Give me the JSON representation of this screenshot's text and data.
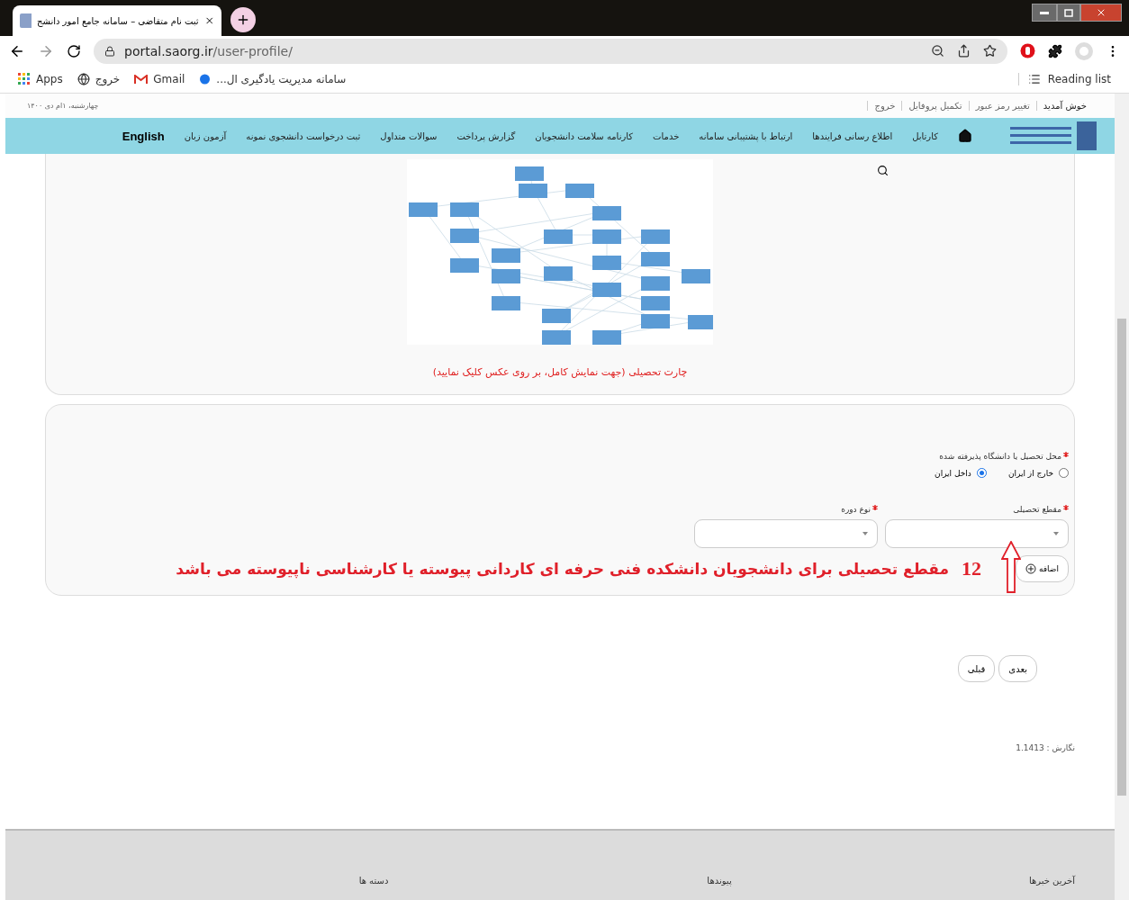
{
  "browser": {
    "tab_title": "ثبت نام متقاضی – سامانه جامع امور دانشج",
    "url_host": "portal.saorg.ir",
    "url_path": "/user-profile/",
    "bookmarks": {
      "apps": "Apps",
      "globe_link": "خروج",
      "gmail": "Gmail",
      "cloud_link": "سامانه مدیریت یادگیری ال..."
    },
    "reading_list": "Reading list"
  },
  "site": {
    "top_links": [
      "خوش آمدید",
      "تغییر رمز عبور",
      "تکمیل پروفایل",
      "خروج"
    ],
    "date": "چهارشنبه، ۱ام دی ۱۴۰۰",
    "nav": [
      {
        "kind": "home"
      },
      {
        "kind": "link",
        "label": "کارتابل"
      },
      {
        "kind": "link",
        "label": "اطلاع رسانی فرایندها"
      },
      {
        "kind": "link",
        "label": "ارتباط با پشتیبانی سامانه"
      },
      {
        "kind": "link",
        "label": "خدمات"
      },
      {
        "kind": "link",
        "label": "کارنامه سلامت دانشجویان"
      },
      {
        "kind": "link",
        "label": "گزارش پرداخت"
      },
      {
        "kind": "link",
        "label": "سوالات متداول"
      },
      {
        "kind": "link",
        "label": "ثبت درخواست دانشجوی نمونه"
      },
      {
        "kind": "link",
        "label": "آزمون زبان"
      },
      {
        "kind": "lang",
        "label": "English"
      }
    ]
  },
  "chart_caption": "چارت تحصیلی (جهت نمایش کامل، بر روی عکس کلیک نمایید)",
  "form": {
    "location_label": "محل تحصیل یا دانشگاه پذیرفته شده",
    "location_required": true,
    "radios": [
      {
        "label": "خارج از ایران",
        "selected": false
      },
      {
        "label": "داخل ایران",
        "selected": true
      }
    ],
    "fields": [
      {
        "label": "مقطع تحصیلی",
        "required": true
      },
      {
        "label": "نوع دوره",
        "required": true
      }
    ],
    "add_button": "اضافه"
  },
  "annotation": {
    "number": "12",
    "text": "مقطع تحصیلی برای دانشجویان دانشکده فنی حرفه ای کاردانی پیوسته یا کارشناسی ناپیوسته می باشد"
  },
  "step_buttons": [
    "بعدی",
    "قبلی"
  ],
  "version": "نگارش : 1.1413",
  "footer": [
    "آخرین خبرها",
    "پیوندها",
    "دسته ها"
  ]
}
